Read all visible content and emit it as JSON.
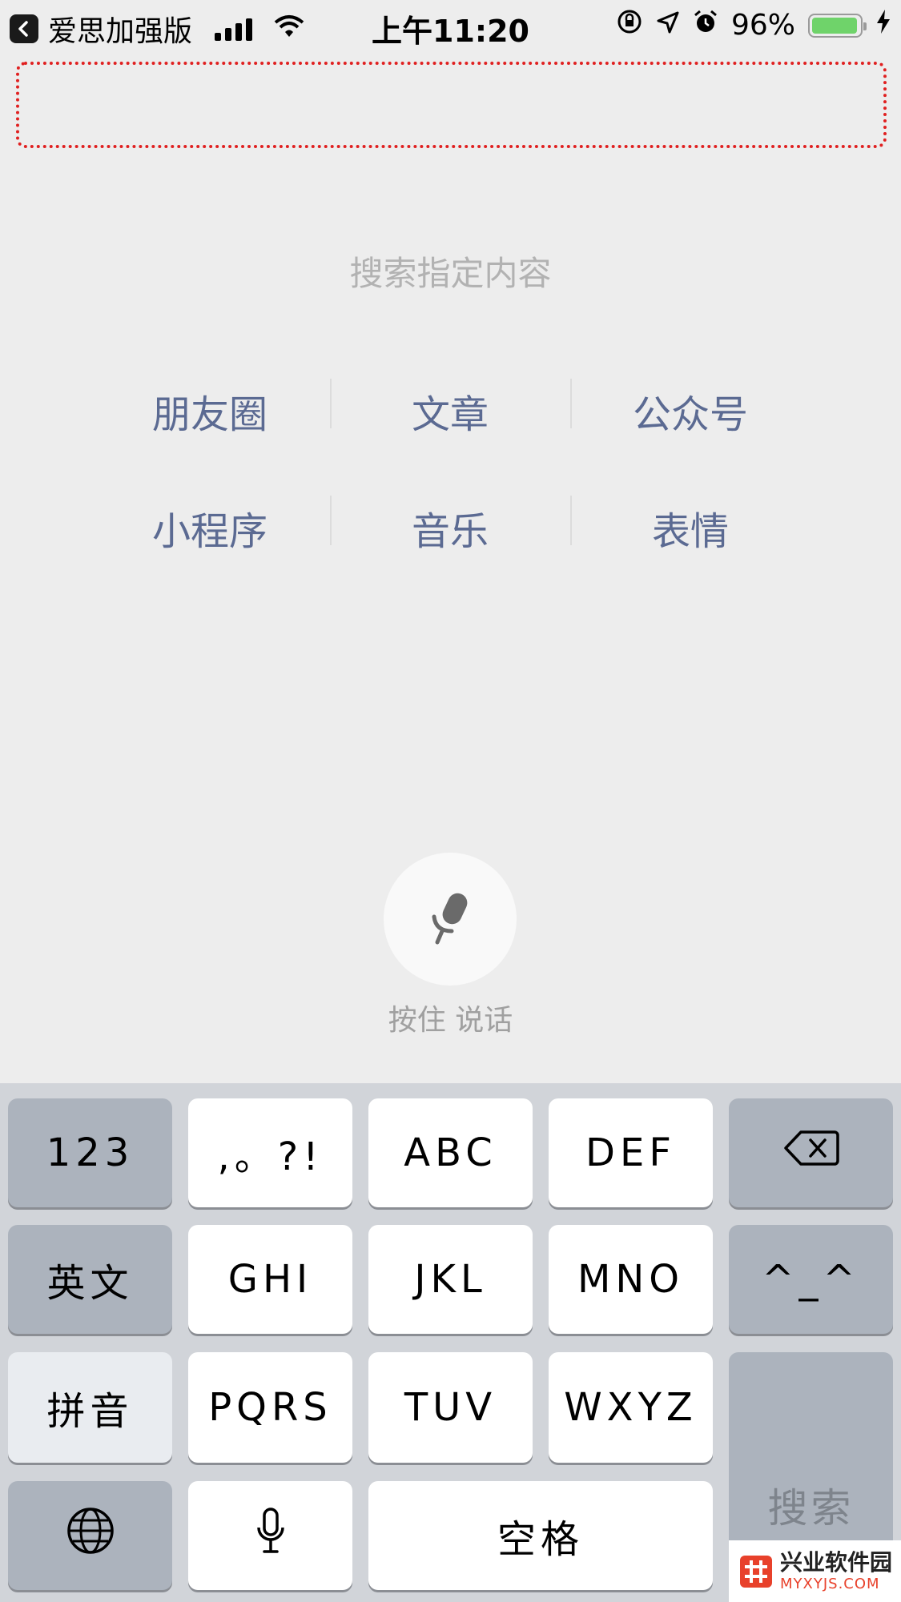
{
  "status_bar": {
    "carrier": "爱思加强版",
    "time": "上午11:20",
    "battery": "96%",
    "battery_level": 0.96,
    "icons": [
      "back-icon",
      "signal-icon",
      "wifi-icon",
      "orientation-lock-icon",
      "location-icon",
      "alarm-icon",
      "battery-icon",
      "charging-icon"
    ]
  },
  "search": {
    "hint": "搜索指定内容",
    "categories": [
      "朋友圈",
      "文章",
      "公众号",
      "小程序",
      "音乐",
      "表情"
    ]
  },
  "voice": {
    "label": "按住 说话",
    "icon": "microphone-icon"
  },
  "keyboard": {
    "row1": [
      "123",
      ",。?!",
      "ABC",
      "DEF"
    ],
    "row2": [
      "英文",
      "GHI",
      "JKL",
      "MNO",
      "^_^"
    ],
    "row3": [
      "拼音",
      "PQRS",
      "TUV",
      "WXYZ"
    ],
    "search_key": "搜索",
    "space_key": "空格",
    "icons": [
      "backspace-icon",
      "globe-icon",
      "keyboard-mic-icon"
    ]
  },
  "watermark": {
    "title": "兴业软件园",
    "url": "MYXYJS.COM"
  },
  "colors": {
    "background": "#ededed",
    "link_blue": "#5b6a92",
    "hint_gray": "#b2b2b2",
    "keyboard_bg": "#d1d4d9",
    "dashed_outline": "#e02020"
  }
}
